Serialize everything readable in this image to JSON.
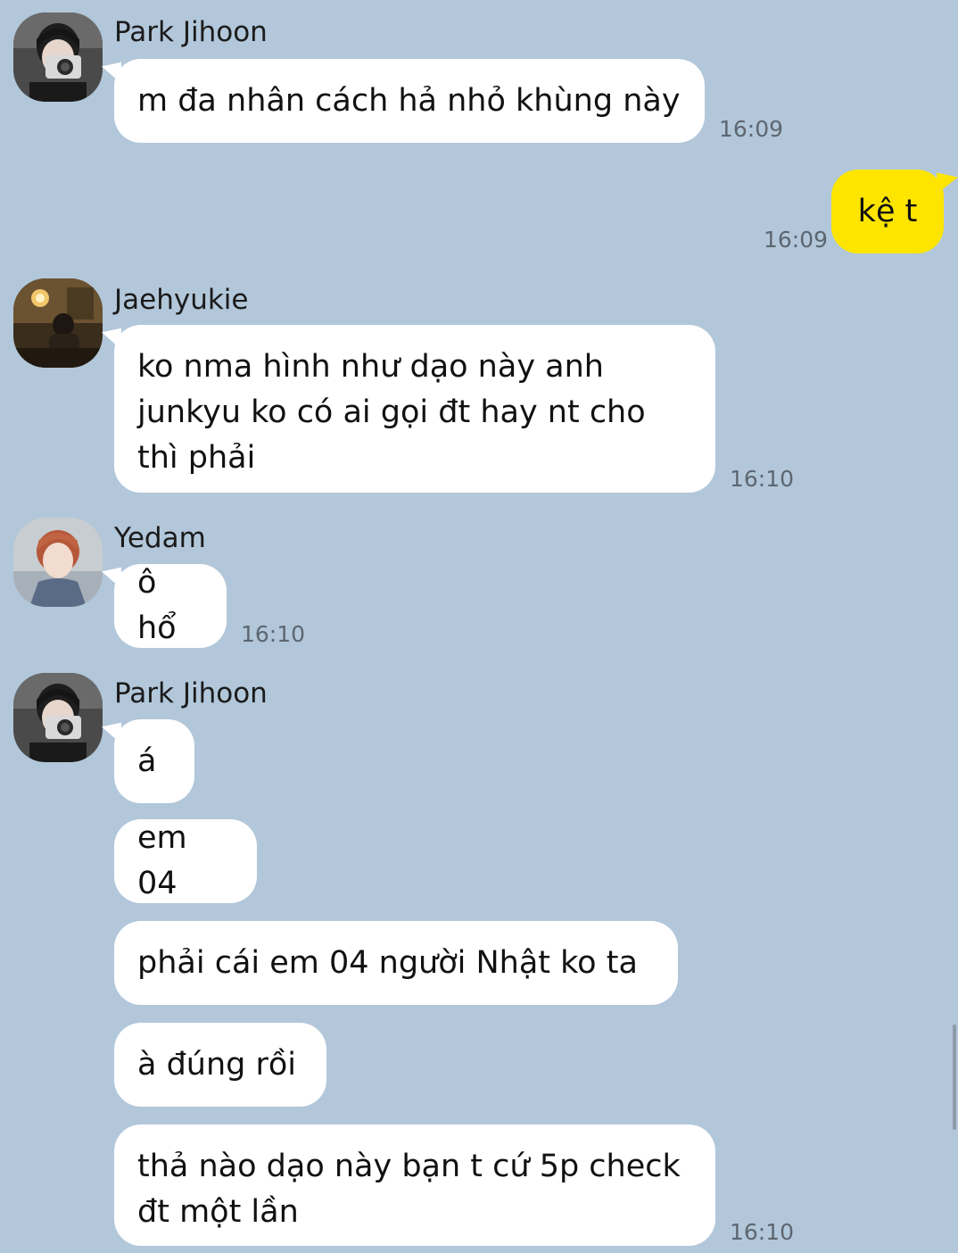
{
  "messages": [
    {
      "sender": "Park Jihoon",
      "text": "m đa nhân cách hả nhỏ khùng này",
      "time": "16:09"
    },
    {
      "sender": "me",
      "text": "kệ t",
      "time": "16:09"
    },
    {
      "sender": "Jaehyukie",
      "text": "ko nma hình như dạo này anh junkyu ko có ai gọi đt hay nt cho thì phải",
      "time": "16:10"
    },
    {
      "sender": "Yedam",
      "text": "ô hổ",
      "time": "16:10"
    },
    {
      "sender": "Park Jihoon",
      "lines": [
        "á",
        "em 04",
        "phải cái em 04 người Nhật ko ta",
        "à đúng rồi",
        "thả nào dạo này bạn t cứ 5p check đt một lần"
      ],
      "time": "16:10"
    }
  ],
  "colors": {
    "background": "#b2c7da",
    "incoming_bubble": "#ffffff",
    "outgoing_bubble": "#fee500"
  }
}
